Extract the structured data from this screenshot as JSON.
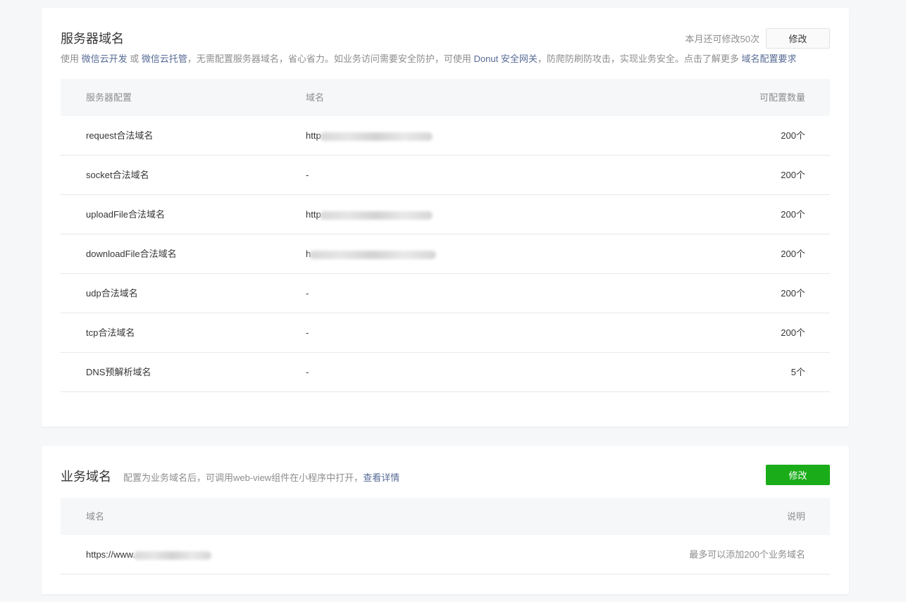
{
  "server": {
    "title": "服务器域名",
    "quota_text": "本月还可修改50次",
    "modify_label": "修改",
    "desc": {
      "t1": "使用 ",
      "link1": "微信云开发",
      "t2": " 或 ",
      "link2": "微信云托管",
      "t3": "，无需配置服务器域名，省心省力。如业务访问需要安全防护，可使用 ",
      "link3": "Donut 安全网关",
      "t4": "，防爬防刷防攻击，实现业务安全。点击了解更多 ",
      "link4": "域名配置要求"
    },
    "columns": [
      "服务器配置",
      "域名",
      "可配置数量"
    ],
    "rows": [
      {
        "config": "request合法域名",
        "domain": "http",
        "count": "200个",
        "redacted": true
      },
      {
        "config": "socket合法域名",
        "domain": "-",
        "count": "200个",
        "redacted": false
      },
      {
        "config": "uploadFile合法域名",
        "domain": "http",
        "count": "200个",
        "redacted": true
      },
      {
        "config": "downloadFile合法域名",
        "domain": "h",
        "count": "200个",
        "redacted": true
      },
      {
        "config": "udp合法域名",
        "domain": "-",
        "count": "200个",
        "redacted": false
      },
      {
        "config": "tcp合法域名",
        "domain": "-",
        "count": "200个",
        "redacted": false
      },
      {
        "config": "DNS预解析域名",
        "domain": "-",
        "count": "5个",
        "redacted": false
      }
    ]
  },
  "business": {
    "title": "业务域名",
    "desc_text": "配置为业务域名后，可调用web-view组件在小程序中打开，",
    "desc_link": "查看详情",
    "modify_label": "修改",
    "columns": [
      "域名",
      "说明"
    ],
    "rows": [
      {
        "domain": "https://www.",
        "note": "最多可以添加200个业务域名"
      }
    ]
  },
  "colors": {
    "primary_green": "#1aad19",
    "link_blue": "#576b95",
    "muted_gray": "#8d8d8d"
  }
}
